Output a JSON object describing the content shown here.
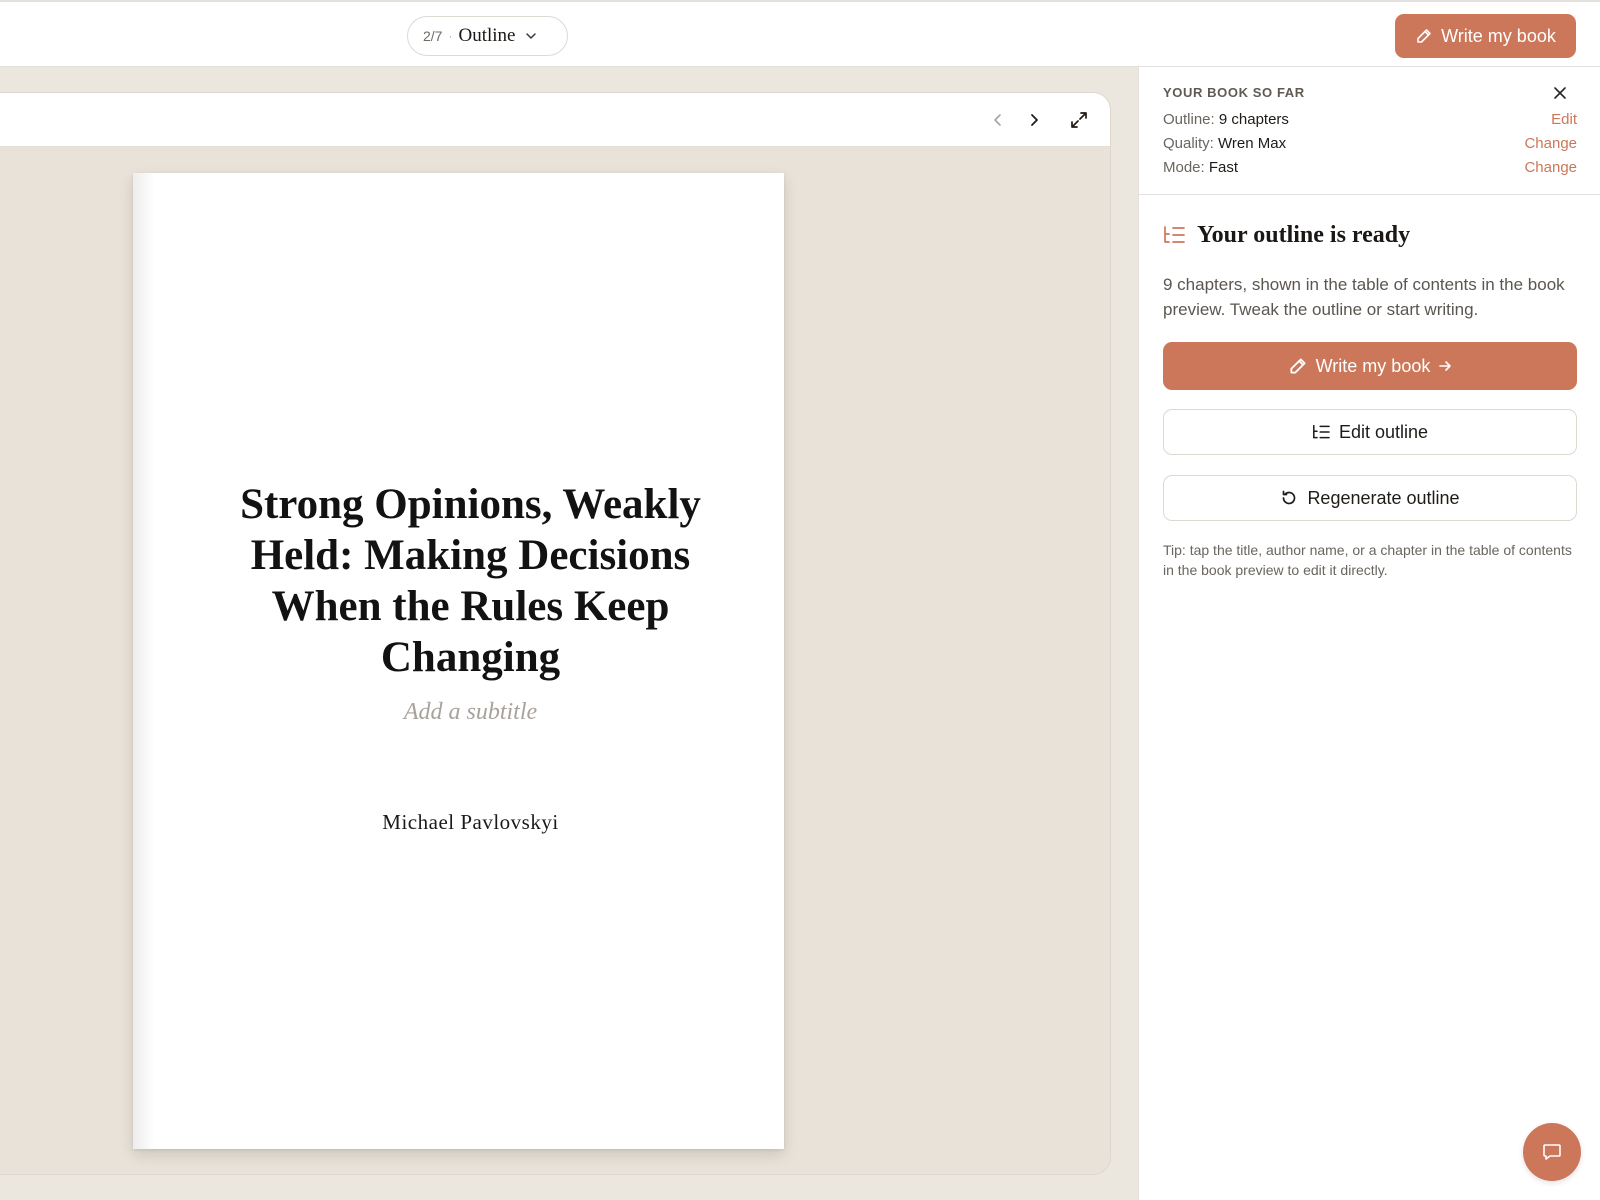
{
  "topbar": {
    "step_count": "2/7",
    "step_separator": "·",
    "step_label": "Outline",
    "step_dropdown_icon": "chevron-down-icon",
    "write_button_label": "Write my book",
    "write_button_icon": "pencil-icon"
  },
  "preview": {
    "toolbar": {
      "prev_icon": "chevron-left-icon",
      "next_icon": "chevron-right-icon",
      "fullscreen_icon": "expand-icon"
    },
    "book": {
      "title": "Strong Opinions, Weakly Held: Making Decisions When the Rules Keep Changing",
      "subtitle_placeholder": "Add a subtitle",
      "author": "Michael Pavlovskyi"
    }
  },
  "sidebar": {
    "summary": {
      "heading": "YOUR BOOK SO FAR",
      "close_icon": "close-icon",
      "rows": [
        {
          "label": "Outline:",
          "value": "9 chapters",
          "action": "Edit"
        },
        {
          "label": "Quality:",
          "value": "Wren Max",
          "action": "Change"
        },
        {
          "label": "Mode:",
          "value": "Fast",
          "action": "Change"
        }
      ]
    },
    "outline": {
      "icon": "outline-list-icon",
      "title": "Your outline is ready",
      "description": "9 chapters, shown in the table of contents in the book preview. Tweak the outline or start writing.",
      "write_button": "Write my book",
      "write_icon": "pencil-icon",
      "write_arrow_icon": "arrow-right-icon",
      "edit_button": "Edit outline",
      "edit_icon": "outline-list-icon",
      "regenerate_button": "Regenerate outline",
      "regenerate_icon": "refresh-icon",
      "tip": "Tip: tap the title, author name, or a chapter in the table of contents in the book preview to edit it directly."
    }
  },
  "chat": {
    "icon": "chat-bubble-icon"
  },
  "colors": {
    "accent": "#cc7759",
    "canvas_background": "#ece7de",
    "page_background": "#ffffff"
  }
}
